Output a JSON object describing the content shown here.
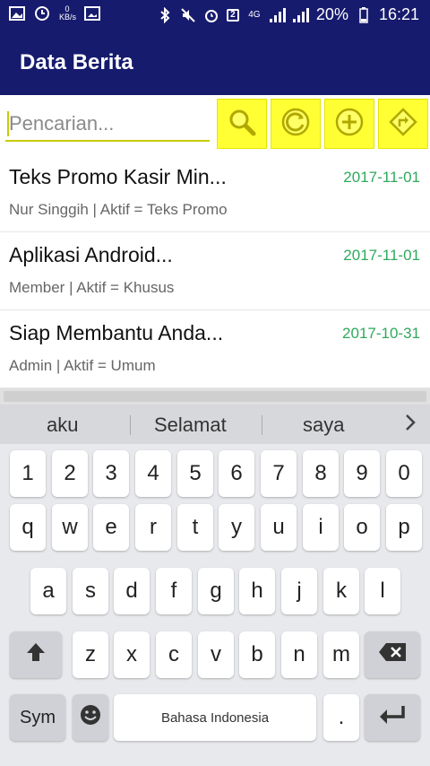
{
  "status_bar": {
    "kbs_top": "0",
    "kbs_bottom": "KB/s",
    "network": "4G",
    "sim": "2",
    "battery": "20%",
    "time": "16:21"
  },
  "app": {
    "title": "Data Berita"
  },
  "search": {
    "placeholder": "Pencarian...",
    "value": "",
    "buttons": [
      {
        "name": "search-button",
        "icon": "search-icon"
      },
      {
        "name": "refresh-button",
        "icon": "refresh-icon"
      },
      {
        "name": "add-button",
        "icon": "plus-icon"
      },
      {
        "name": "route-button",
        "icon": "direction-sign-icon"
      }
    ]
  },
  "news": [
    {
      "title": "Teks Promo Kasir Min...",
      "date": "2017-11-01",
      "meta": "Nur Singgih | Aktif = Teks Promo"
    },
    {
      "title": "Aplikasi Android...",
      "date": "2017-11-01",
      "meta": "Member | Aktif = Khusus"
    },
    {
      "title": "Siap Membantu Anda...",
      "date": "2017-10-31",
      "meta": "Admin | Aktif = Umum"
    }
  ],
  "keyboard": {
    "suggestions": [
      "aku",
      "Selamat",
      "saya"
    ],
    "row_numbers": [
      "1",
      "2",
      "3",
      "4",
      "5",
      "6",
      "7",
      "8",
      "9",
      "0"
    ],
    "row1": [
      "q",
      "w",
      "e",
      "r",
      "t",
      "y",
      "u",
      "i",
      "o",
      "p"
    ],
    "row2": [
      "a",
      "s",
      "d",
      "f",
      "g",
      "h",
      "j",
      "k",
      "l"
    ],
    "row3": [
      "z",
      "x",
      "c",
      "v",
      "b",
      "n",
      "m"
    ],
    "sym_label": "Sym",
    "space_label": "Bahasa Indonesia",
    "period": "."
  },
  "colors": {
    "primary": "#171b6e",
    "accent_button": "#ffff33",
    "date_green": "#2eaa5c"
  }
}
